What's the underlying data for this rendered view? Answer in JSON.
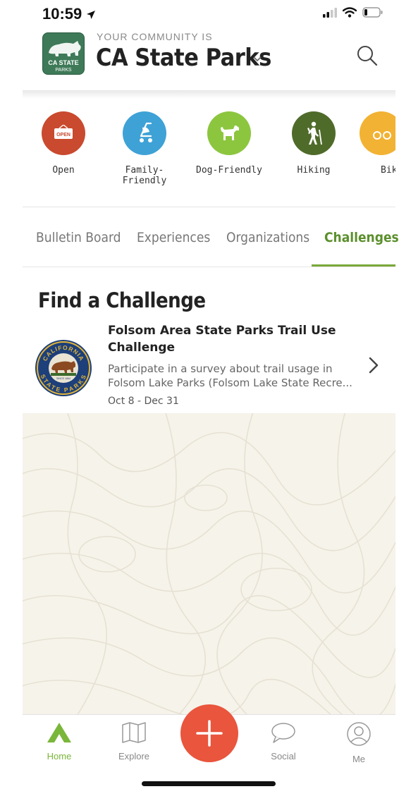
{
  "status_bar": {
    "time": "10:59",
    "icons": [
      "location-arrow-icon",
      "signal-icon",
      "wifi-icon",
      "battery-icon"
    ]
  },
  "header": {
    "logo": {
      "line1": "CA STATE",
      "line2": "PARKS"
    },
    "community_label": "YOUR COMMUNITY IS",
    "community_name": "CA State Parks"
  },
  "categories": [
    {
      "label": "Open",
      "icon": "open-sign-icon",
      "color": "#c94a2e",
      "badge": "OPEN"
    },
    {
      "label": "Family-Friendly",
      "icon": "stroller-icon",
      "color": "#3ea2d6"
    },
    {
      "label": "Dog-Friendly",
      "icon": "dog-icon",
      "color": "#8cc63f"
    },
    {
      "label": "Hiking",
      "icon": "hiker-icon",
      "color": "#4f6b2a"
    },
    {
      "label": "Bik",
      "icon": "bike-icon",
      "color": "#f2b233"
    }
  ],
  "tabs": [
    {
      "label": "Bulletin Board",
      "active": false
    },
    {
      "label": "Experiences",
      "active": false
    },
    {
      "label": "Organizations",
      "active": false
    },
    {
      "label": "Challenges",
      "active": true
    }
  ],
  "section_title": "Find a Challenge",
  "challenge": {
    "title": "Folsom Area State Parks Trail Use Challenge",
    "description_line1": "Participate in a survey about trail usage in",
    "description_line2": "Folsom Lake Parks (Folsom Lake State Recre...",
    "dates": "Oct 8 - Dec 31",
    "seal": {
      "top_text": "CALIFORNIA",
      "bottom_text": "STATE PARKS",
      "since": "SINCE 1864"
    }
  },
  "bottom_nav": [
    {
      "label": "Home",
      "icon": "home-triangle-icon",
      "active": true
    },
    {
      "label": "Explore",
      "icon": "map-icon",
      "active": false
    },
    {
      "label": "",
      "icon": "plus-icon",
      "active": false
    },
    {
      "label": "Social",
      "icon": "chat-bubble-icon",
      "active": false
    },
    {
      "label": "Me",
      "icon": "user-icon",
      "active": false
    }
  ],
  "colors": {
    "accent_green": "#7ab63a",
    "create_button": "#e9553d",
    "map_background": "#f6f3ea"
  }
}
